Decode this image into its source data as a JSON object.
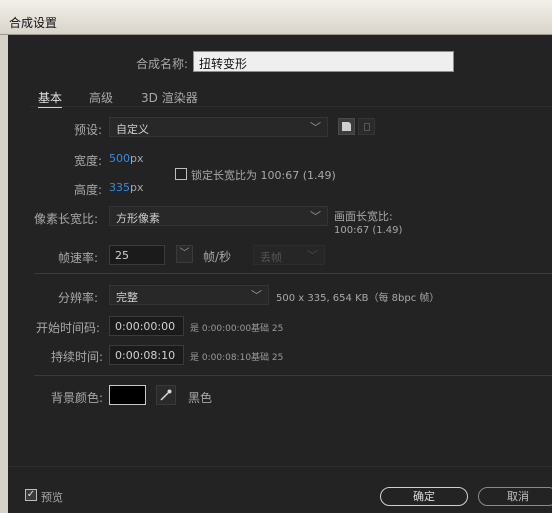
{
  "window": {
    "title": "合成设置"
  },
  "comp_name": {
    "label": "合成名称:",
    "value": "扭转变形"
  },
  "tabs": [
    {
      "label": "基本",
      "active": true
    },
    {
      "label": "高级",
      "active": false
    },
    {
      "label": "3D 渲染器",
      "active": false
    }
  ],
  "preset": {
    "label": "预设:",
    "value": "自定义"
  },
  "width": {
    "label": "宽度:",
    "value": "500",
    "unit": "px"
  },
  "height": {
    "label": "高度:",
    "value": "335",
    "unit": "px"
  },
  "lock_ratio": {
    "label": "锁定长宽比为 100:67 (1.49)",
    "checked": false
  },
  "pixel_aspect": {
    "label": "像素长宽比:",
    "value": "方形像素"
  },
  "frame_aspect": {
    "label": "画面长宽比:",
    "value": "100:67 (1.49)"
  },
  "frame_rate": {
    "label": "帧速率:",
    "value": "25",
    "unit": "帧/秒",
    "drop": "丢帧"
  },
  "resolution": {
    "label": "分辨率:",
    "value": "完整",
    "info": "500 x 335, 654 KB（每 8bpc 帧）"
  },
  "start_timecode": {
    "label": "开始时间码:",
    "value": "0:00:00:00",
    "is": "是 0:00:00:00",
    "base": "基础 25"
  },
  "duration": {
    "label": "持续时间:",
    "value": "0:00:08:10",
    "is": "是 0:00:08:10",
    "base": "基础 25"
  },
  "background": {
    "label": "背景颜色:",
    "color_name": "黑色",
    "color": "#000000"
  },
  "footer": {
    "preview_label": "预览",
    "preview_checked": true,
    "ok_label": "确定",
    "cancel_label": "取消"
  },
  "colors": {
    "accent": "#2d8ceb",
    "panel": "#232323"
  }
}
